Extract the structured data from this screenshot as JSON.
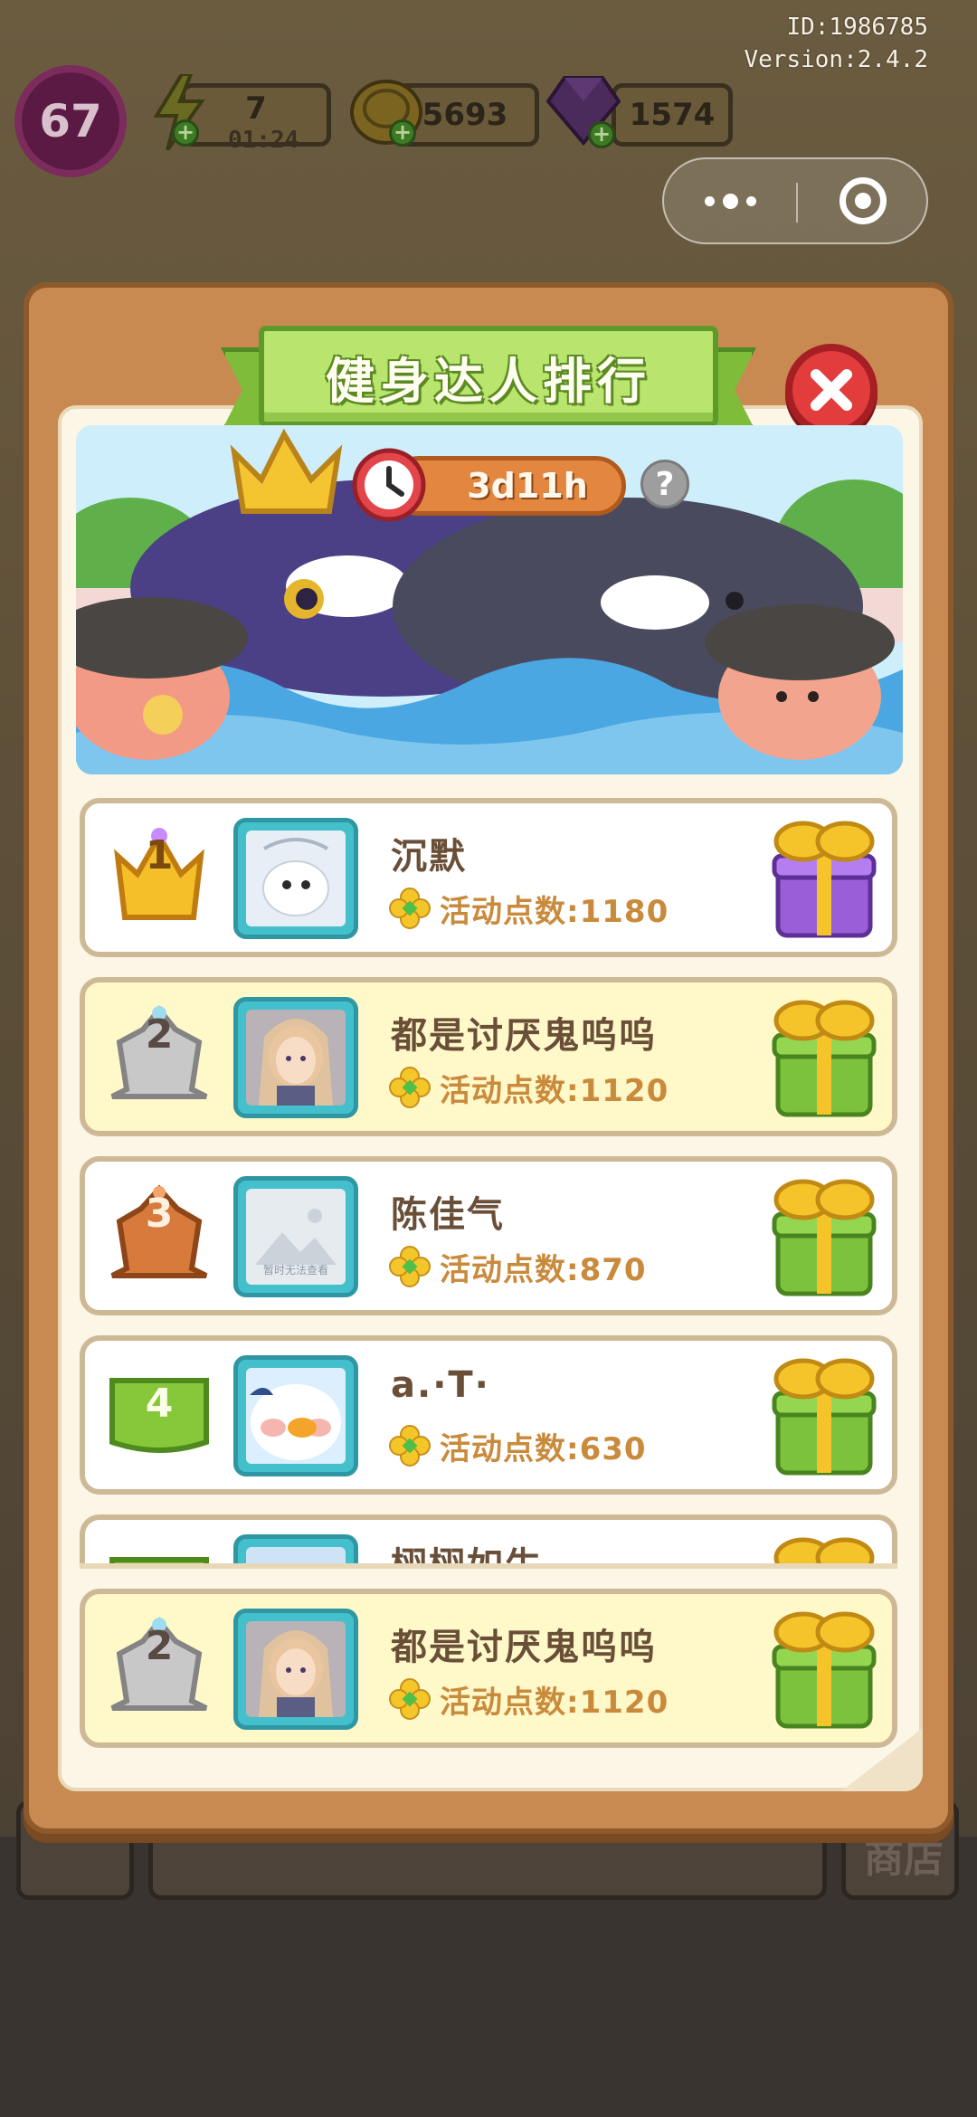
{
  "hud": {
    "id_label": "ID:1986785",
    "version_label": "Version:2.4.2",
    "level": "67",
    "energy": "7",
    "energy_timer": "01:24",
    "coins": "5693",
    "gems": "1574"
  },
  "capsule": {
    "more_icon": "more-dots-icon",
    "close_icon": "target-circle-icon"
  },
  "background": {
    "shop_label": "商店"
  },
  "modal": {
    "title": "健身达人排行",
    "countdown": "3d11h",
    "help_label": "?"
  },
  "ranking": [
    {
      "rank": "1",
      "name": "沉默",
      "points_label": "活动点数:1180",
      "badge": "gold-crown",
      "gift_color": "#9a5fd8"
    },
    {
      "rank": "2",
      "name": "都是讨厌鬼呜呜",
      "points_label": "活动点数:1120",
      "badge": "silver-crown",
      "gift_color": "#7cc23c"
    },
    {
      "rank": "3",
      "name": "陈佳气",
      "points_label": "活动点数:870",
      "badge": "bronze-crown",
      "gift_color": "#7cc23c"
    },
    {
      "rank": "4",
      "name": "a.·T·",
      "points_label": "活动点数:630",
      "badge": "green-flag",
      "gift_color": "#7cc23c"
    },
    {
      "rank": "",
      "name": "栩栩如生",
      "points_label": "",
      "badge": "green-flag",
      "gift_color": "#7cc23c"
    }
  ],
  "my_rank": {
    "rank": "2",
    "name": "都是讨厌鬼呜呜",
    "points_label": "活动点数:1120",
    "badge": "silver-crown",
    "gift_color": "#7cc23c"
  },
  "avatar_placeholder_text": "暂时无法查看",
  "colors": {
    "frame": "#c98a52",
    "ribbon": "#b9e46e",
    "close": "#e23c3c",
    "highlight_row": "#fff8c8",
    "points_text": "#c98a3c"
  }
}
